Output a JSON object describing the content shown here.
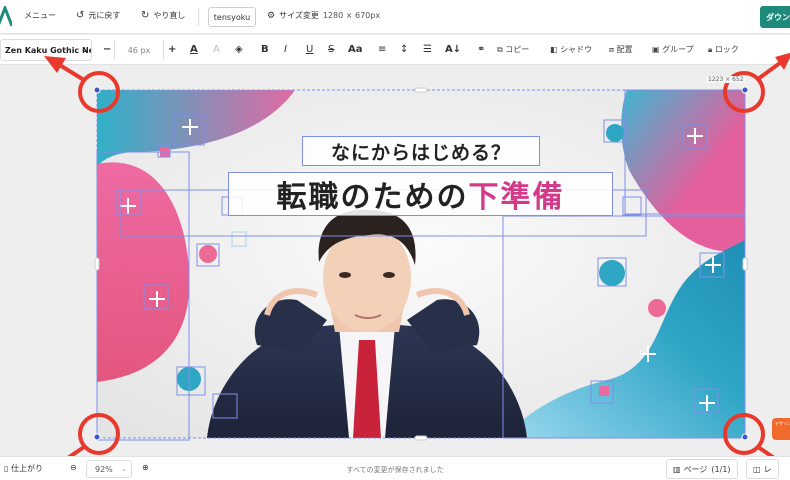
{
  "toolbar_top": {
    "menu_label": "メニュー",
    "undo_label": "元に戻す",
    "redo_label": "やり直し",
    "project_name": "tensyoku",
    "resize_label": "サイズ変更",
    "size_readout": "1280 × 670px",
    "download_label": "ダウン"
  },
  "format_toolbar": {
    "font_name": "Zen Kaku Gothic Ne",
    "font_size": "46 px",
    "copy_label": "コピー",
    "shadow_label": "シャドウ",
    "arrange_label": "配置",
    "group_label": "グループ",
    "lock_label": "ロック"
  },
  "canvas": {
    "selection_size": "1223 × 652",
    "heading_small": "なにからはじめる？",
    "heading_main_black": "転職のための",
    "heading_main_pink": "下準備",
    "badge_text": "デザイン"
  },
  "bottom_bar": {
    "finish_label": "仕上がり",
    "zoom_value": "92%",
    "status_text": "すべての変更が保存されました",
    "page_label": "ページ",
    "page_count": "(1/1)",
    "layer_label": "レ"
  },
  "colors": {
    "accent": "#1e8a7c",
    "arrow_red": "#e8392c",
    "pink_text": "#d43a8a",
    "selection_blue": "#7f8fe8"
  }
}
